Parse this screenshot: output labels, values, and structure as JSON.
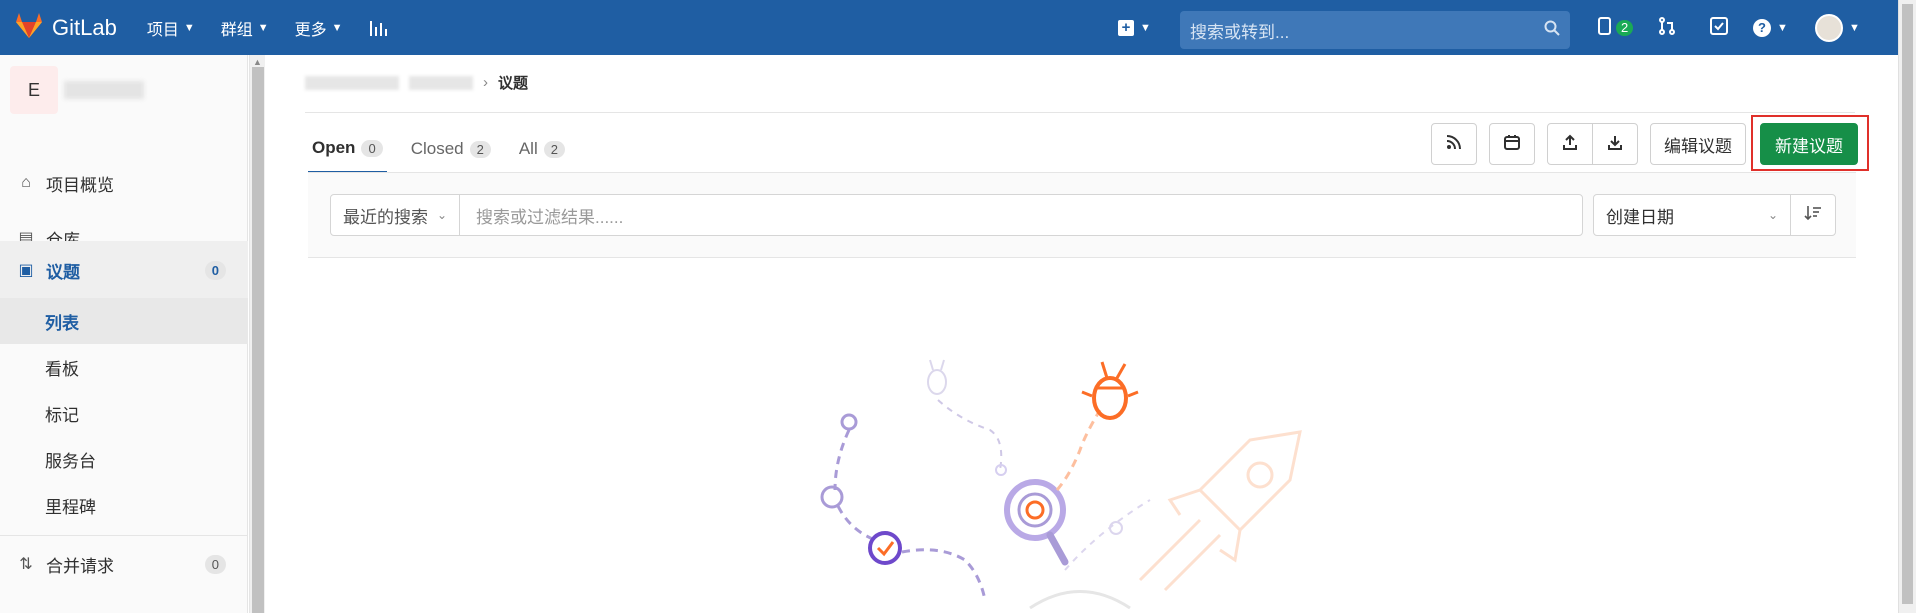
{
  "navbar": {
    "brand": "GitLab",
    "menu": [
      {
        "label": "项目"
      },
      {
        "label": "群组"
      },
      {
        "label": "更多"
      }
    ],
    "search_placeholder": "搜索或转到...",
    "todo_count": "2",
    "brand_color": "#1f5ea3"
  },
  "sidebar": {
    "project_initial": "E",
    "items": [
      {
        "label": "项目概览",
        "icon": "home-icon"
      },
      {
        "label": "仓库",
        "icon": "file-icon"
      },
      {
        "label": "议题",
        "icon": "issues-icon",
        "count": "0"
      },
      {
        "label": "合并请求",
        "icon": "merge-request-icon",
        "count": "0"
      }
    ],
    "issues_sub": [
      {
        "label": "列表"
      },
      {
        "label": "看板"
      },
      {
        "label": "标记"
      },
      {
        "label": "服务台"
      },
      {
        "label": "里程碑"
      }
    ]
  },
  "breadcrumb": {
    "current": "议题"
  },
  "tabs": [
    {
      "label": "Open",
      "count": "0"
    },
    {
      "label": "Closed",
      "count": "2"
    },
    {
      "label": "All",
      "count": "2"
    }
  ],
  "actions": {
    "edit_issues": "编辑议题",
    "new_issue": "新建议题",
    "accent_color": "#168f48"
  },
  "filter": {
    "recent_searches": "最近的搜索",
    "placeholder": "搜索或过滤结果......",
    "sort_by": "创建日期"
  }
}
